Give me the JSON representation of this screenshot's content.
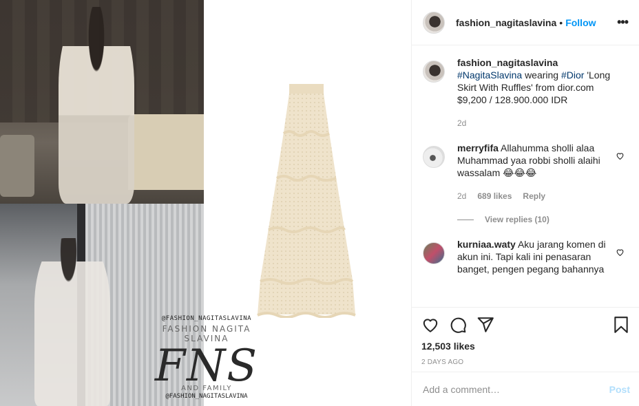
{
  "post": {
    "username": "fashion_nagitaslavina",
    "follow_separator": "•",
    "follow_label": "Follow",
    "more_icon": "more-horizontal-icon"
  },
  "caption": {
    "username": "fashion_nagitaslavina",
    "tag1": "#NagitaSlavina",
    "text1": "wearing",
    "tag2": "#Dior",
    "text2": "'Long Skirt With Ruffles' from dior.com $9,200 / 128.900.000 IDR",
    "time": "2d"
  },
  "comments": [
    {
      "username": "merryfifa",
      "text": "Allahumma sholli alaa Muhammad yaa robbi sholli alaihi wassalam 😂😂😂",
      "time": "2d",
      "likes": "689 likes",
      "reply_label": "Reply",
      "view_replies": "View replies (10)"
    },
    {
      "username": "kurniaa.waty",
      "text": "Aku jarang komen di akun ini. Tapi kali ini penasaran banget, pengen pegang bahannya"
    }
  ],
  "actions": {
    "likes": "12,503 likes",
    "ago": "2 DAYS AGO"
  },
  "add_comment": {
    "placeholder": "Add a comment…",
    "post_label": "Post"
  },
  "watermark": {
    "handle_top": "@FASHION_NAGITASLAVINA",
    "name": "FASHION NAGITA SLAVINA",
    "logo": "FNS",
    "family": "AND FAMILY",
    "handle_bottom": "@FASHION_NAGITASLAVINA"
  },
  "colors": {
    "accent": "#0095f6",
    "post_disabled": "#b2dffc",
    "hashtag": "#00376b",
    "muted": "#8e8e8e"
  }
}
